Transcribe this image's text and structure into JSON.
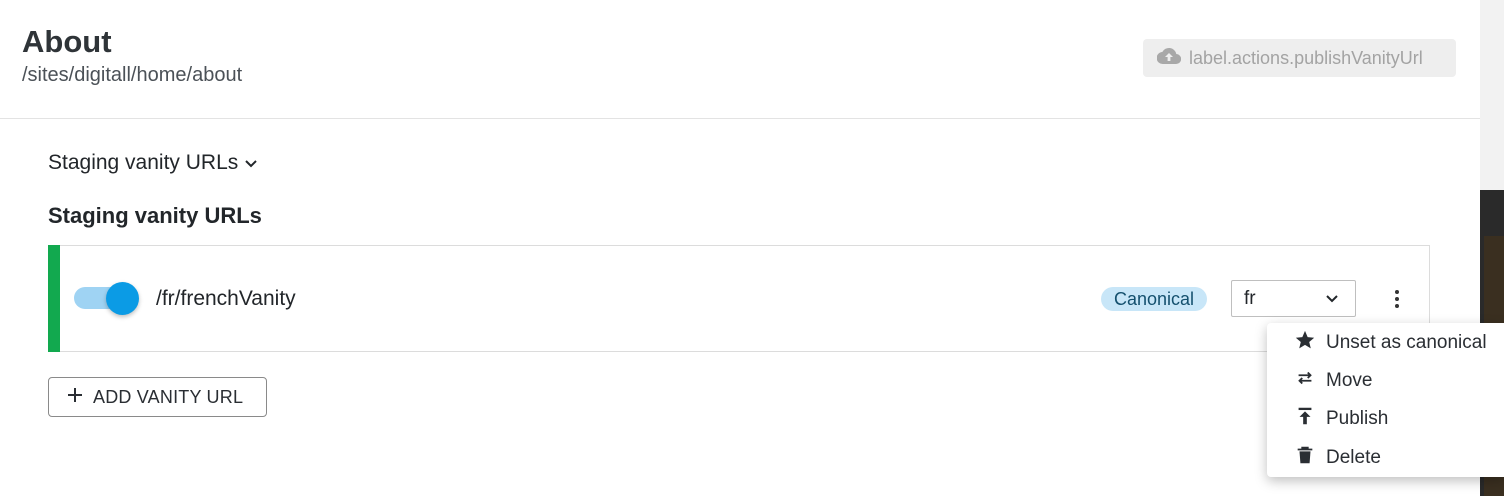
{
  "header": {
    "title": "About",
    "path": "/sites/digitall/home/about",
    "publish_label": "label.actions.publishVanityUrl"
  },
  "section": {
    "dropdown_label": "Staging vanity URLs",
    "title": "Staging vanity URLs"
  },
  "vanity_rows": [
    {
      "url": "/fr/frenchVanity",
      "active": true,
      "badge": "Canonical",
      "language": "fr"
    }
  ],
  "add_button_label": "ADD VANITY URL",
  "context_menu": {
    "items": [
      {
        "label": "Unset as canonical",
        "icon": "star-icon"
      },
      {
        "label": "Move",
        "icon": "swap-icon"
      },
      {
        "label": "Publish",
        "icon": "publish-icon"
      },
      {
        "label": "Delete",
        "icon": "trash-icon"
      }
    ]
  },
  "colors": {
    "accent_green": "#12a94f",
    "toggle_blue": "#0b9be5",
    "badge_bg": "#c8e6f8"
  }
}
